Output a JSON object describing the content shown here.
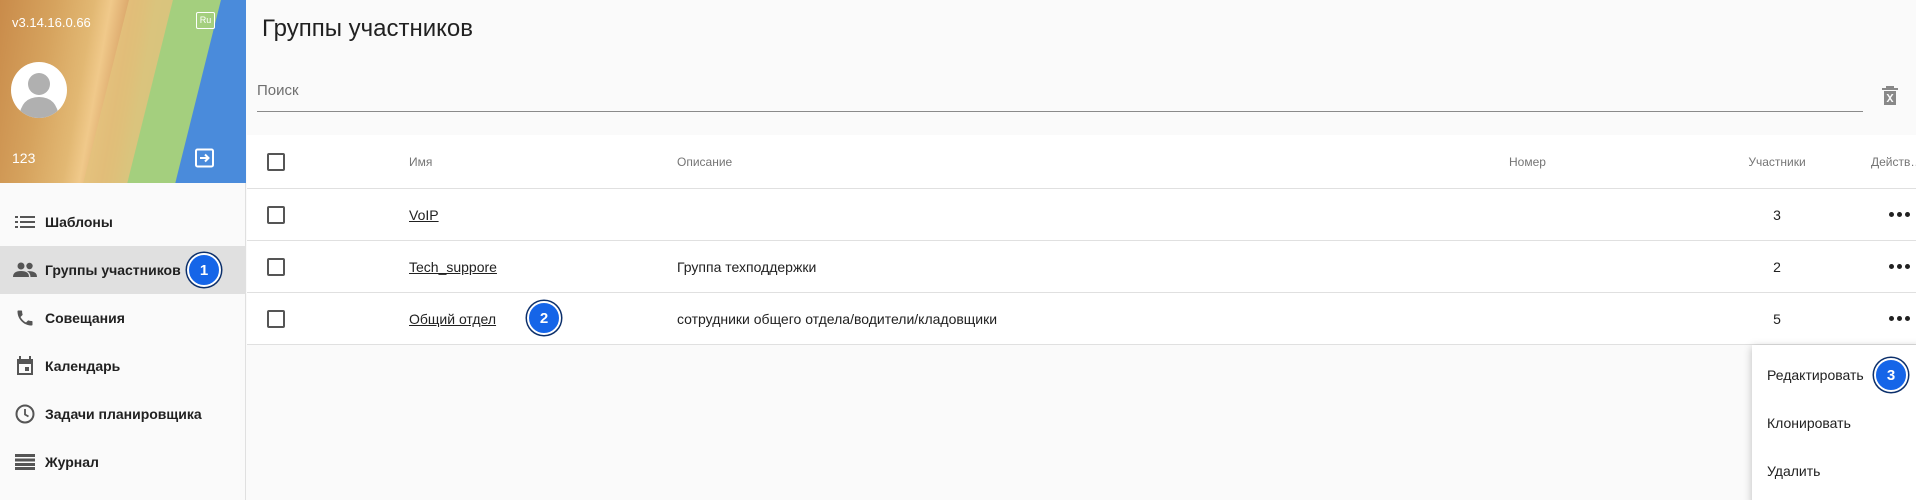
{
  "sidebar": {
    "version": "v3.14.16.0.66",
    "lang": "Ru",
    "user_number": "123",
    "items": [
      {
        "label": "Шаблоны",
        "icon": "list-icon"
      },
      {
        "label": "Группы участников",
        "icon": "people-icon",
        "active": true
      },
      {
        "label": "Совещания",
        "icon": "phone-icon"
      },
      {
        "label": "Календарь",
        "icon": "calendar-icon"
      },
      {
        "label": "Задачи планировщика",
        "icon": "clock-icon"
      },
      {
        "label": "Журнал",
        "icon": "journal-icon"
      }
    ]
  },
  "main": {
    "title": "Группы участников",
    "search": {
      "placeholder": "Поиск",
      "value": ""
    },
    "table": {
      "columns": [
        "Имя",
        "Описание",
        "Номер",
        "Участники",
        "Действ…"
      ],
      "rows": [
        {
          "name": "VoIP",
          "description": "",
          "number": "",
          "participants": "3"
        },
        {
          "name": "Tech_suppore",
          "description": "Группа техподдержки",
          "number": "",
          "participants": "2"
        },
        {
          "name": "Общий отдел",
          "description": "сотрудники общего отдела/водители/кладовщики",
          "number": "",
          "participants": "5"
        }
      ]
    },
    "actions_menu": [
      "Редактировать",
      "Клонировать",
      "Удалить"
    ]
  },
  "annotations": {
    "b1": "1",
    "b2": "2",
    "b3": "3"
  },
  "colors": {
    "accent": "#1565e8",
    "active_bg": "#e0e0e0"
  }
}
